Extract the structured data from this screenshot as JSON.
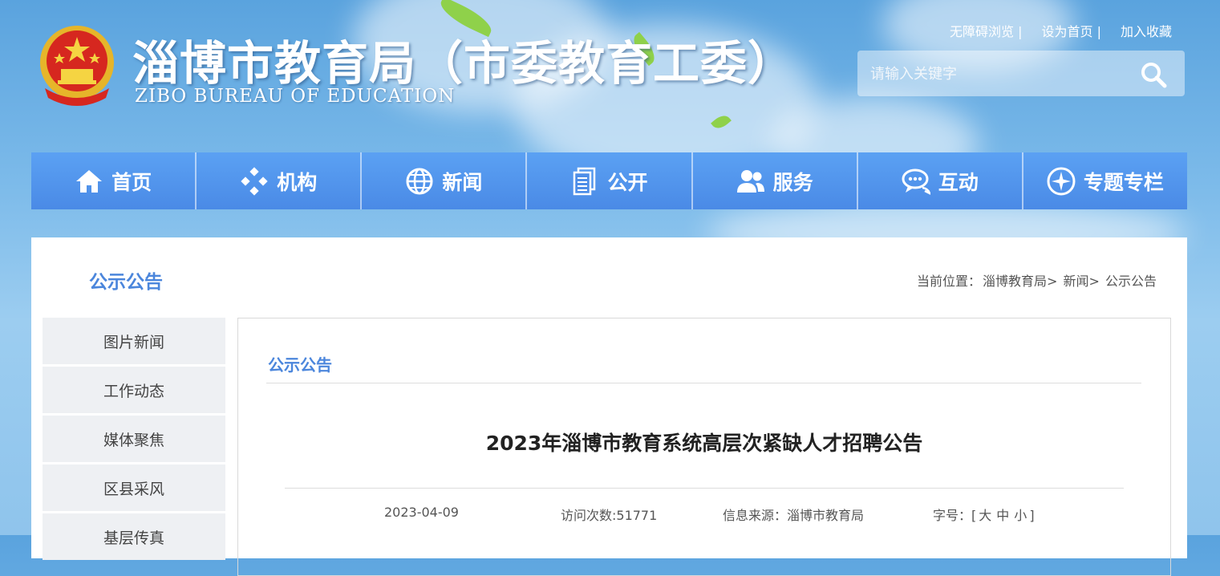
{
  "header": {
    "title": "淄博市教育局（市委教育工委）",
    "subtitle": "ZIBO BUREAU OF EDUCATION",
    "top_links": [
      "无障碍浏览 |",
      "设为首页 |",
      "加入收藏"
    ],
    "search_placeholder": "请输入关键字"
  },
  "nav": {
    "items": [
      {
        "label": "首页",
        "icon": "home-icon"
      },
      {
        "label": "机构",
        "icon": "diamond-cluster-icon"
      },
      {
        "label": "新闻",
        "icon": "globe-icon"
      },
      {
        "label": "公开",
        "icon": "document-stack-icon"
      },
      {
        "label": "服务",
        "icon": "people-icon"
      },
      {
        "label": "互动",
        "icon": "chat-bubble-icon"
      },
      {
        "label": "专题专栏",
        "icon": "compass-icon"
      }
    ]
  },
  "main": {
    "section_title": "公示公告",
    "breadcrumb": {
      "prefix": "当前位置：",
      "items": [
        "淄博教育局>",
        "新闻>",
        "公示公告"
      ]
    },
    "sidebar": [
      "图片新闻",
      "工作动态",
      "媒体聚焦",
      "区县采风",
      "基层传真"
    ],
    "content": {
      "header": "公示公告",
      "article_title": "2023年淄博市教育系统高层次紧缺人才招聘公告",
      "date": "2023-04-09",
      "visits": "访问次数:51771",
      "source": "信息来源：淄博市教育局",
      "font_label": "字号：",
      "font_open": "[",
      "font_sizes": [
        "大",
        "中",
        "小"
      ],
      "font_close": "]"
    }
  },
  "colors": {
    "nav_bg": "#4a8ae6",
    "accent_text": "#4b86dc",
    "sky": "#7dbbea"
  }
}
